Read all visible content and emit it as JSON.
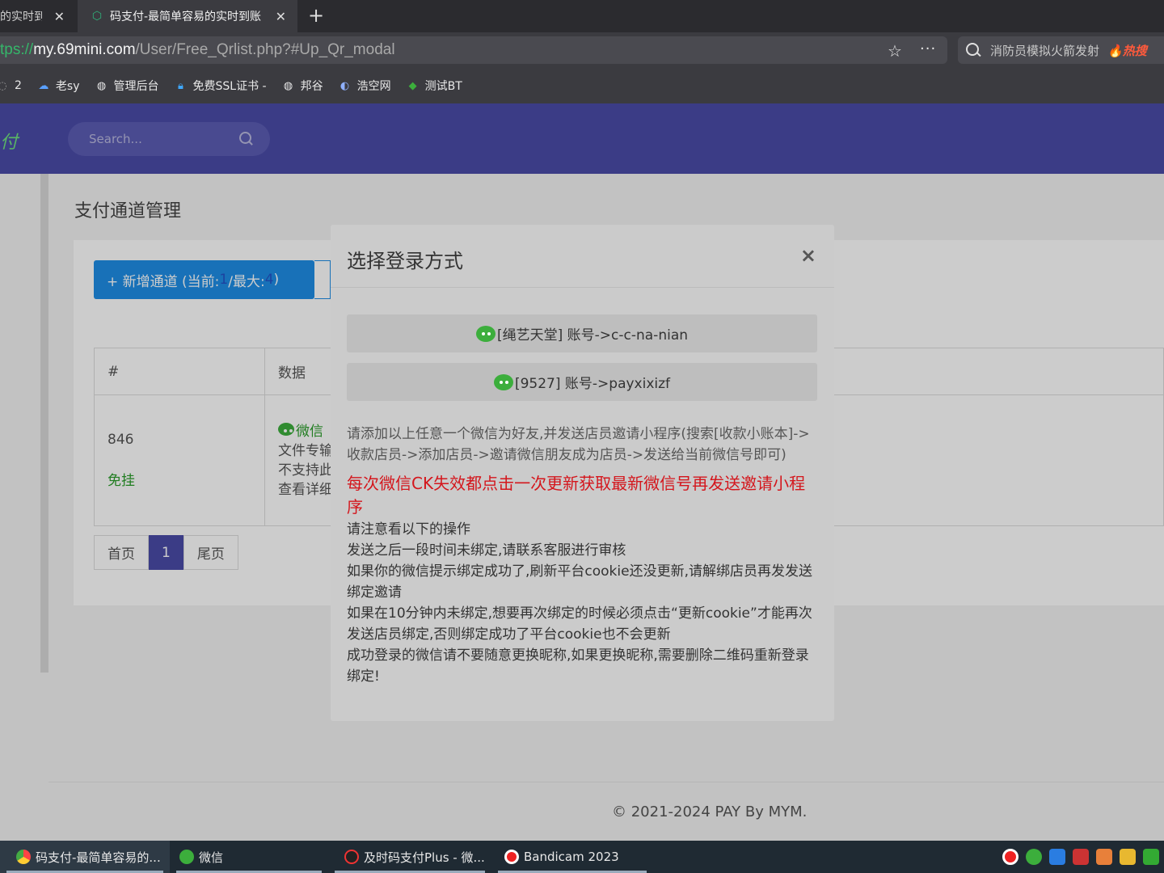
{
  "browser": {
    "tabs": [
      {
        "title": "的实时到",
        "active": false
      },
      {
        "title": "码支付-最简单容易的实时到账",
        "active": true
      }
    ],
    "url": {
      "proto": "tps://",
      "host": "my.69mini.com",
      "path": "/User/Free_Qrlist.php?#Up_Qr_modal"
    },
    "search": {
      "text": "消防员模拟火箭发射",
      "hot": "热搜"
    },
    "bookmarks": [
      {
        "label": "2"
      },
      {
        "label": "老sy"
      },
      {
        "label": "管理后台"
      },
      {
        "label": "免费SSL证书 -"
      },
      {
        "label": "邦谷"
      },
      {
        "label": "浩空网"
      },
      {
        "label": "测试BT"
      }
    ]
  },
  "site": {
    "logo": "付",
    "search_placeholder": "Search...",
    "page_title": "支付通道管理",
    "add_button": {
      "prefix": "+ 新增通道 (当前: ",
      "current": "1",
      "mid": "/最大: ",
      "max": "4",
      "suffix": ")"
    },
    "table": {
      "headers": [
        "#",
        "数据"
      ],
      "row": {
        "id": "846",
        "status": "免挂",
        "type": "微信",
        "lines": [
          "文件专输",
          "不支持此",
          "查看详细"
        ]
      }
    },
    "pager": {
      "first": "首页",
      "current": "1",
      "last": "尾页"
    },
    "footer": "© 2021-2024 PAY By MYM."
  },
  "modal": {
    "title": "选择登录方式",
    "close": "×",
    "accounts": [
      "[绳艺天堂] 账号->c-c-na-nian",
      "[9527] 账号->payxixizf"
    ],
    "instruction": "请添加以上任意一个微信为好友,并发送店员邀请小程序(搜索[收款小账本]->收款店员->添加店员->邀请微信朋友成为店员->发送给当前微信号即可)",
    "warning": "每次微信CK失效都点击一次更新获取最新微信号再发送邀请小程序",
    "notes": [
      "请注意看以下的操作",
      "发送之后一段时间未绑定,请联系客服进行审核",
      "如果你的微信提示绑定成功了,刷新平台cookie还没更新,请解绑店员再发发送绑定邀请",
      "如果在10分钟内未绑定,想要再次绑定的时候必须点击“更新cookie”才能再次发送店员绑定,否则绑定成功了平台cookie也不会更新",
      "成功登录的微信请不要随意更换昵称,如果更换昵称,需要删除二维码重新登录绑定!"
    ]
  },
  "taskbar": {
    "tasks": [
      "码支付-最简单容易的...",
      "微信",
      "及时码支付Plus - 微...",
      "Bandicam 2023"
    ]
  },
  "colors": {
    "nav": "#4a4ba8",
    "primary": "#1e8ee6",
    "warning": "#d4161c",
    "wechat": "#3cae3c"
  }
}
